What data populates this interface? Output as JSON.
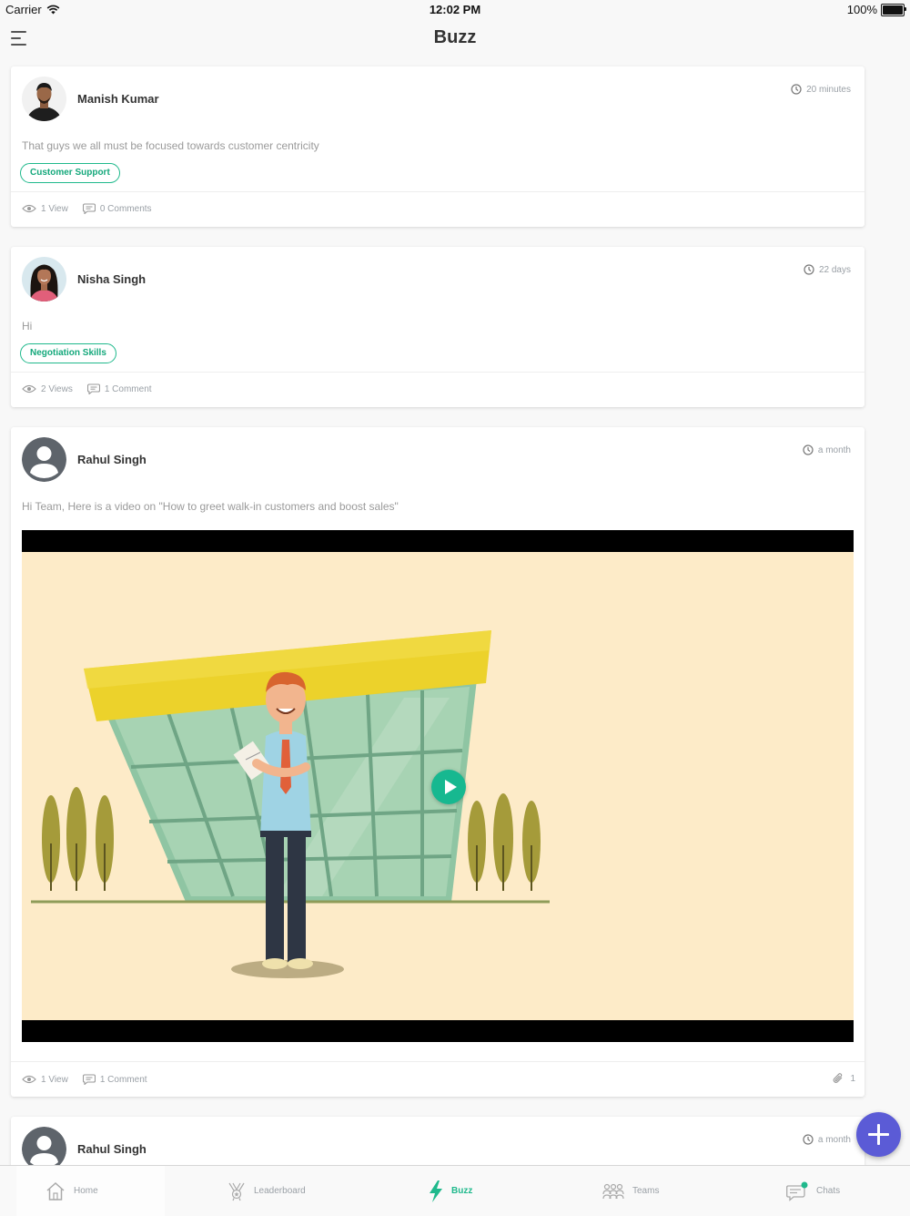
{
  "status_bar": {
    "carrier": "Carrier",
    "time": "12:02 PM",
    "battery": "100%",
    "battery_level": 1.0
  },
  "nav": {
    "title": "Buzz",
    "menu_icon": "hamburger-menu-icon"
  },
  "posts": [
    {
      "author": "Manish Kumar",
      "time": "20 minutes",
      "text": "That guys we all must be focused towards customer centricity",
      "tag": "Customer Support",
      "views": "1 View",
      "comments": "0 Comments"
    },
    {
      "author": "Nisha Singh",
      "time": "22 days",
      "text": "Hi",
      "tag": "Negotiation Skills",
      "views": "2 Views",
      "comments": "1 Comment"
    },
    {
      "author": "Rahul Singh",
      "time": "a month",
      "text": "Hi Team, Here is a video on \"How to greet walk-in customers and boost sales\"",
      "views": "1 View",
      "comments": "1 Comment",
      "attachments": "1"
    },
    {
      "author": "Rahul Singh",
      "time": "a month"
    }
  ],
  "tabs": [
    {
      "label": "Home",
      "icon": "home-icon"
    },
    {
      "label": "Leaderboard",
      "icon": "trophy-icon"
    },
    {
      "label": "Buzz",
      "icon": "lightning-icon",
      "active": true
    },
    {
      "label": "Teams",
      "icon": "teams-icon"
    },
    {
      "label": "Chats",
      "icon": "chat-icon"
    }
  ],
  "colors": {
    "accent": "#1fb98c",
    "fab": "#5b5bd6",
    "video_bg": "#fdebc8",
    "roof": "#ecd22b"
  }
}
